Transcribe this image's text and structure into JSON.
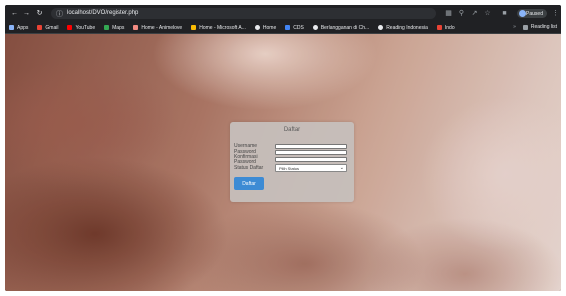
{
  "browser": {
    "url": "localhost/DVO/register.php",
    "profile_label": "Paused",
    "bookmarks": [
      {
        "label": "Apps",
        "icon": "apps-grid-icon",
        "color": "#8ab4f8"
      },
      {
        "label": "Gmail",
        "icon": "gmail-icon",
        "color": "#ea4335"
      },
      {
        "label": "YouTube",
        "icon": "youtube-icon",
        "color": "#ff0000"
      },
      {
        "label": "Maps",
        "icon": "maps-icon",
        "color": "#34a853"
      },
      {
        "label": "Home - Animelove",
        "icon": "page-icon",
        "color": "#f28b82"
      },
      {
        "label": "Home - Microsoft A...",
        "icon": "microsoft-icon",
        "color": "#fbbc04"
      },
      {
        "label": "Home",
        "icon": "github-icon",
        "color": "#e8eaed"
      },
      {
        "label": "CDS",
        "icon": "cds-icon",
        "color": "#4285f4"
      },
      {
        "label": "Berlangganan di Ch...",
        "icon": "google-icon",
        "color": "#e8eaed"
      },
      {
        "label": "Reading Indonesia",
        "icon": "google-icon",
        "color": "#e8eaed"
      },
      {
        "label": "Indo",
        "icon": "indo-icon",
        "color": "#ea4335"
      }
    ],
    "reading_list_label": "Reading list"
  },
  "form": {
    "title": "Daftar",
    "username_label": "Username",
    "password_label": "Password",
    "confirm_password_label": "Konfirmasi Password",
    "status_label": "Status Daftar",
    "status_selected": "Pilih Status",
    "submit_label": "Daftar"
  },
  "colors": {
    "submit_button": "#3d8bd4",
    "card_background": "#c6bfbc"
  }
}
